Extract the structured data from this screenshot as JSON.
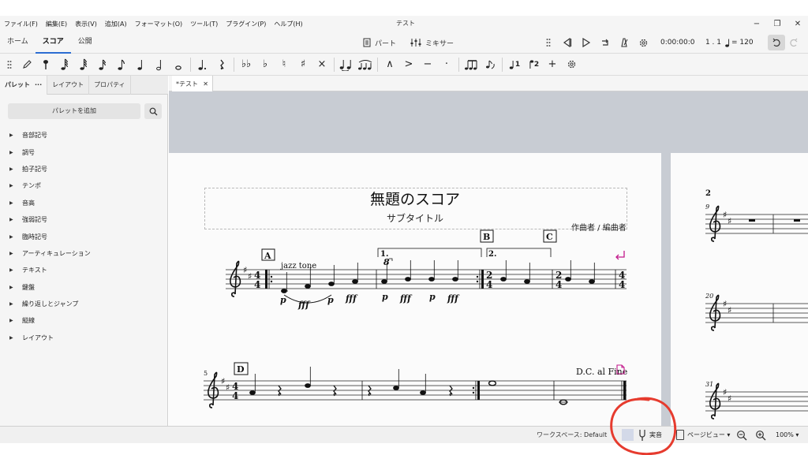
{
  "window": {
    "title": "テスト",
    "minimize": "−",
    "maximize": "❐",
    "close": "✕"
  },
  "menu": [
    "ファイル(F)",
    "編集(E)",
    "表示(V)",
    "追加(A)",
    "フォーマット(O)",
    "ツール(T)",
    "プラグイン(P)",
    "ヘルプ(H)"
  ],
  "main_tabs": [
    "ホーム",
    "スコア",
    "公開"
  ],
  "active_main_tab": "スコア",
  "center_tools": {
    "parts": "パート",
    "mixer": "ミキサー"
  },
  "playback": {
    "time": "0:00:00:0",
    "measure": "1 . 1",
    "tempo": "= 120"
  },
  "note_toolbar": {
    "accidentals": [
      "♭♭",
      "♭",
      "♮",
      "♯",
      "×"
    ],
    "articulations": [
      "∧",
      ">",
      "−",
      "·"
    ],
    "voices": [
      "1",
      "2"
    ],
    "add": "+"
  },
  "panel_tabs": [
    "パレット",
    "···",
    "レイアウト",
    "プロパティ"
  ],
  "add_palette_label": "パレットを追加",
  "palettes": [
    "音部記号",
    "調号",
    "拍子記号",
    "テンポ",
    "音高",
    "強弱記号",
    "臨時記号",
    "アーティキュレーション",
    "テキスト",
    "鍵盤",
    "繰り返しとジャンプ",
    "縦線",
    "レイアウト"
  ],
  "doc_tab": {
    "label": "*テスト",
    "close": "✕"
  },
  "score": {
    "title": "無題のスコア",
    "subtitle": "サブタイトル",
    "composer": "作曲者 / 編曲者",
    "staff_text": "jazz tone",
    "rehearsal_marks": [
      "A",
      "B",
      "C",
      "D"
    ],
    "volta_labels": [
      "1.",
      "2."
    ],
    "ottava": "8",
    "dynamics": [
      "p",
      "fff",
      "p",
      "fff",
      "p",
      "fff",
      "p",
      "fff"
    ],
    "time_signatures": [
      "4/4",
      "2/4",
      "2/4",
      "4/4"
    ],
    "jump_text": "D.C. al Fine",
    "system2_measure_number": "5",
    "page2_number": "2",
    "page2_measure_numbers": [
      "9",
      "20",
      "31"
    ]
  },
  "statusbar": {
    "workspace": "ワークスペース: Default",
    "concert_pitch": "実音",
    "page_view": "ページビュー ▾",
    "zoom": "100% ▾"
  },
  "colors": {
    "background": "#ffffff",
    "toolbar": "#f5f5f5",
    "canvas": "#c8ccd3",
    "active_tab_underline": "#2c6dd2",
    "annotation_red": "#e63b2e",
    "layout_break_magenta": "#c2188b"
  }
}
